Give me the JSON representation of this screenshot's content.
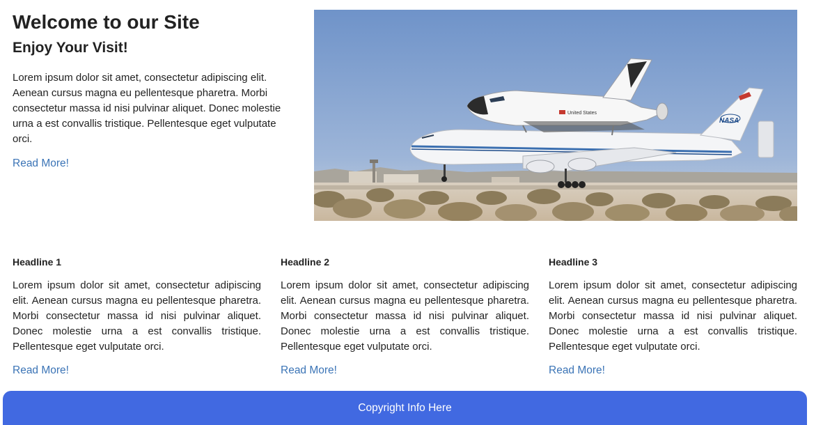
{
  "hero": {
    "title": "Welcome to our Site",
    "subtitle": "Enjoy Your Visit!",
    "body": "Lorem ipsum dolor sit amet, consectetur adipiscing elit. Aenean cursus magna eu pellentesque pharetra. Morbi consectetur massa id nisi pulvinar aliquet. Donec molestie urna a est convallis tristique. Pellentesque eget vulputate orci.",
    "read_more": "Read More!",
    "image_labels": {
      "shuttle": "United States",
      "carrier": "NASA"
    }
  },
  "columns": [
    {
      "headline": "Headline 1",
      "body": "Lorem ipsum dolor sit amet, consectetur adipiscing elit. Aenean cursus magna eu pellentesque pharetra. Morbi consectetur massa id nisi pulvinar aliquet. Donec molestie urna a est convallis tristique. Pellentesque eget vulputate orci.",
      "read_more": "Read More!"
    },
    {
      "headline": "Headline 2",
      "body": "Lorem ipsum dolor sit amet, consectetur adipiscing elit. Aenean cursus magna eu pellentesque pharetra. Morbi consectetur massa id nisi pulvinar aliquet. Donec molestie urna a est convallis tristique. Pellentesque eget vulputate orci.",
      "read_more": "Read More!"
    },
    {
      "headline": "Headline 3",
      "body": "Lorem ipsum dolor sit amet, consectetur adipiscing elit. Aenean cursus magna eu pellentesque pharetra. Morbi consectetur massa id nisi pulvinar aliquet. Donec molestie urna a est convallis tristique. Pellentesque eget vulputate orci.",
      "read_more": "Read More!"
    }
  ],
  "footer": {
    "text": "Copyright Info Here"
  },
  "colors": {
    "link": "#3b74b6",
    "footer_bg": "#4169e1",
    "text": "#222222"
  }
}
